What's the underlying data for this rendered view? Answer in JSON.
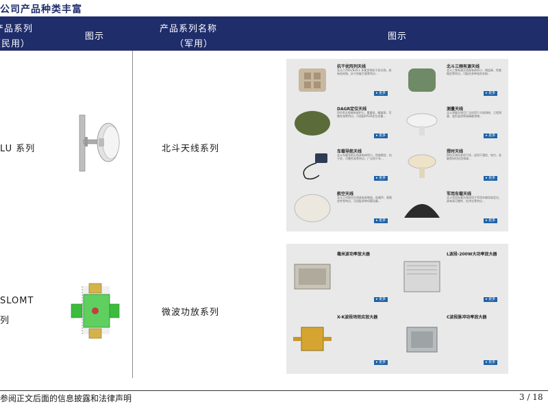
{
  "section_title": "公司产品种类丰富",
  "header": {
    "col1_line1": "产品系列",
    "col1_line2": "（民用）",
    "col2": "图示",
    "col3_line1": "产品系列名称",
    "col3_line2": "（军用）",
    "col4": "图示"
  },
  "rows": [
    {
      "civil": "LU 系列",
      "military": "北斗天线系列"
    },
    {
      "civil_line1": "SLOMT",
      "civil_line2": "系列",
      "military": "微波功放系列"
    }
  ],
  "beidou_cards": [
    {
      "title": "抗干扰阵列天线",
      "desc": "北斗二代B1/B3/L1 多星多频抗干扰天线，具有低仰角、抗干扰能力强等特点...",
      "more": "更多"
    },
    {
      "title": "北斗三频有源天线",
      "desc": "北斗三频有源天线具有体积小、增益高、性能稳定等特点，可配合多种组合导航...",
      "more": "更多"
    },
    {
      "title": "DAGR定位天线",
      "desc": "DAGR天线具有体积小、重量轻、精度高、可靠性强等特点，可适配DAGR定位设备...",
      "more": "更多"
    },
    {
      "title": "测量天线",
      "desc": "北斗测量天线可广泛应用于大地测绘、工程测量、变形监测等高精度领域...",
      "more": "更多"
    },
    {
      "title": "车载导航天线",
      "desc": "北斗车载导航天线具有体积小、性能稳定、抗干扰、可靠性高等特点，广泛用于车...",
      "more": "更多"
    },
    {
      "title": "授时天线",
      "desc": "授时天线抗多径干扰，适用于通信、电力、金融等授时应用领域...",
      "more": "更多"
    },
    {
      "title": "航空天线",
      "desc": "北斗二代航空天线具有高增益、低噪声、高稳定性等特点，可适配多种机载设备...",
      "more": "更多"
    },
    {
      "title": "军用车载天线",
      "desc": "北斗军用车载天线适用于军用车辆导航定位，具有高可靠性、抗冲击等特点...",
      "more": "更多"
    }
  ],
  "amp_cards": [
    {
      "title": "毫米波功率放大器",
      "more": "更多"
    },
    {
      "title": "L波段-200W大功率放大器",
      "more": "更多"
    },
    {
      "title": "X-K波段场效应放大器",
      "more": "更多"
    },
    {
      "title": "C波段脉冲功率放大器",
      "more": "更多"
    }
  ],
  "footer": {
    "disclaimer": "请参阅正文后面的信息披露和法律声明",
    "page": "3 / 18"
  },
  "colors": {
    "header_bg": "#1f2d6b",
    "panel_bg": "#e9e9e9",
    "more_btn": "#1f63a8"
  }
}
